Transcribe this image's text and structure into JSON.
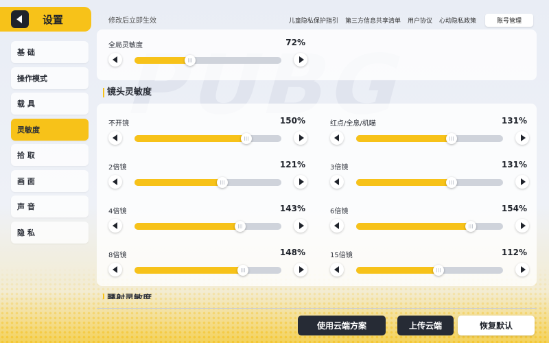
{
  "header": {
    "title": "设置",
    "apply_note": "修改后立即生效",
    "links": [
      "儿童隐私保护指引",
      "第三方信息共享清单",
      "用户协议",
      "心动隐私政策"
    ],
    "account_button": "账号管理"
  },
  "sidebar": {
    "items": [
      {
        "label": "基 础",
        "active": false
      },
      {
        "label": "操作模式",
        "active": false
      },
      {
        "label": "载 具",
        "active": false
      },
      {
        "label": "灵敏度",
        "active": true
      },
      {
        "label": "拾 取",
        "active": false
      },
      {
        "label": "画 面",
        "active": false
      },
      {
        "label": "声 音",
        "active": false
      },
      {
        "label": "隐 私",
        "active": false
      }
    ]
  },
  "global": {
    "label": "全局灵敏度",
    "value_text": "72%",
    "fraction": 0.38
  },
  "scope_section": {
    "title": "镜头灵敏度",
    "sliders": [
      {
        "label": "不开镜",
        "value_text": "150%",
        "fraction": 0.76
      },
      {
        "label": "红点/全息/机瞄",
        "value_text": "131%",
        "fraction": 0.65
      },
      {
        "label": "2倍镜",
        "value_text": "121%",
        "fraction": 0.6
      },
      {
        "label": "3倍镜",
        "value_text": "131%",
        "fraction": 0.65
      },
      {
        "label": "4倍镜",
        "value_text": "143%",
        "fraction": 0.72
      },
      {
        "label": "6倍镜",
        "value_text": "154%",
        "fraction": 0.78
      },
      {
        "label": "8倍镜",
        "value_text": "148%",
        "fraction": 0.74
      },
      {
        "label": "15倍镜",
        "value_text": "112%",
        "fraction": 0.56
      }
    ]
  },
  "next_section": {
    "title": "腰射灵敏度"
  },
  "footer": {
    "use_cloud": "使用云端方案",
    "upload_cloud": "上传云端",
    "restore_default": "恢复默认"
  },
  "colors": {
    "accent": "#f7c219",
    "dark": "#262b35",
    "track": "#cfd3db"
  }
}
